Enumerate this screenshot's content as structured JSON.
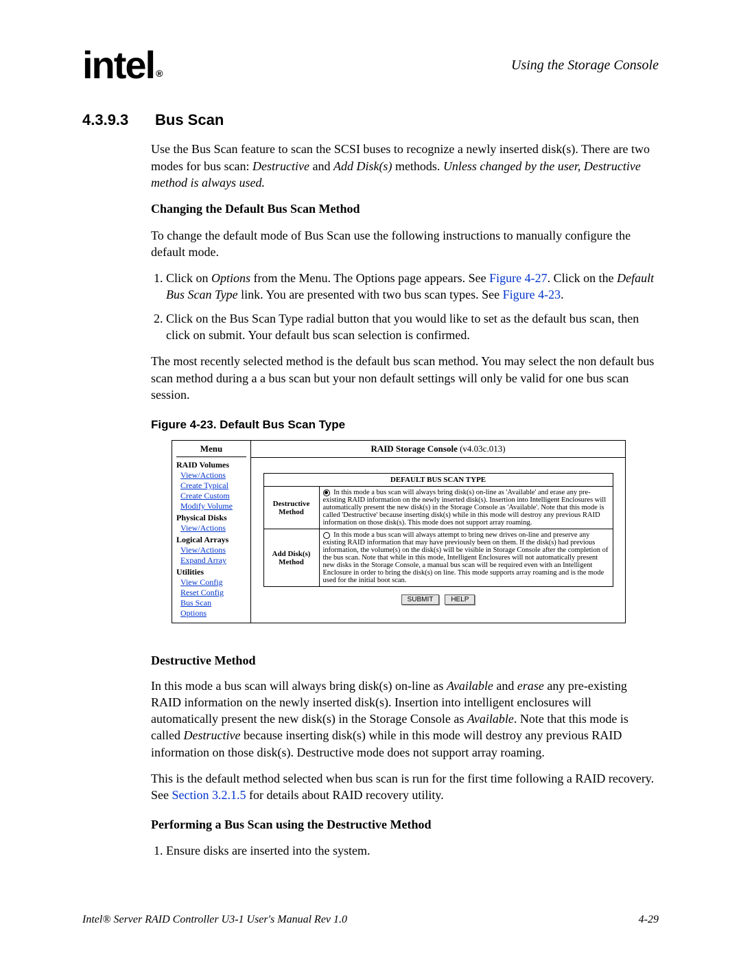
{
  "header": {
    "logo_text": "intel",
    "logo_reg": "®",
    "right": "Using the Storage Console"
  },
  "section": {
    "number": "4.3.9.3",
    "title": "Bus Scan"
  },
  "intro": {
    "p1_a": "Use the Bus Scan feature to scan the SCSI buses to recognize a newly inserted disk(s). There are two modes for bus scan: ",
    "p1_b": "Destructive",
    "p1_c": " and ",
    "p1_d": "Add Disk(s)",
    "p1_e": " methods. ",
    "p1_f": "Unless changed by the user, Destructive method is always used."
  },
  "changing": {
    "heading": "Changing the Default Bus Scan Method",
    "p": "To change the default mode of Bus Scan use the following instructions to manually configure the default mode.",
    "li1_a": "Click on ",
    "li1_b": "Options",
    "li1_c": " from the Menu. The Options page appears. See ",
    "li1_d": "Figure 4-27",
    "li1_e": ". Click on the ",
    "li1_f": "Default Bus Scan Type",
    "li1_g": " link. You are presented with two bus scan types. See ",
    "li1_h": "Figure 4-23",
    "li1_i": ".",
    "li2": "Click on the Bus Scan Type radial button that you would like to set as the default bus scan, then click on submit. Your default bus scan selection is confirmed.",
    "p2": "The most recently selected method is the default bus scan method. You may select the non default bus scan method during a a bus scan but your non default settings will only be valid for one bus scan session."
  },
  "figure_caption": "Figure 4-23. Default Bus Scan Type",
  "console": {
    "menu_title": "Menu",
    "content_title_a": "RAID Storage Console",
    "content_title_b": " (v4.03c.013)",
    "groups": {
      "raid_volumes": "RAID Volumes",
      "physical_disks": "Physical Disks",
      "logical_arrays": "Logical Arrays",
      "utilities": "Utilities"
    },
    "links": {
      "view_actions1": "View/Actions",
      "create_typical": "Create Typical",
      "create_custom": "Create Custom",
      "modify_volume": "Modify Volume",
      "view_actions2": "View/Actions",
      "view_actions3": "View/Actions",
      "expand_array": "Expand Array",
      "view_config": "View Config",
      "reset_config": "Reset Config",
      "bus_scan": "Bus Scan",
      "options": "Options"
    },
    "table_header": "DEFAULT BUS SCAN TYPE",
    "row1": {
      "method": "Destructive Method",
      "desc": " In this mode a bus scan will always bring disk(s) on-line as 'Available' and erase any pre-existing RAID information on the newly inserted disk(s). Insertion into Intelligent Enclosures will automatically present the new disk(s) in the Storage Console as 'Available'. Note that this mode is called 'Destructive' because inserting disk(s) while in this mode will destroy any previous RAID information on those disk(s). This mode does not support array roaming."
    },
    "row2": {
      "method": "Add Disk(s) Method",
      "desc": " In this mode a bus scan will always attempt to bring new drives on-line and preserve any existing RAID information that may have previously been on them. If the disk(s) had previous information, the volume(s) on the disk(s) will be visible in Storage Console after the completion of the bus scan. Note that while in this mode, Intelligent Enclosures will not automatically present new disks in the Storage Console, a manual bus scan will be required even with an Intelligent Enclosure in order to bring the disk(s) on line. This mode supports array roaming and is the mode used for the initial boot scan."
    },
    "buttons": {
      "submit": "SUBMIT",
      "help": "HELP"
    }
  },
  "destructive": {
    "heading": "Destructive Method",
    "p1_a": "In this mode a bus scan will always bring disk(s) on-line as ",
    "p1_b": "Available",
    "p1_c": " and ",
    "p1_d": "erase",
    "p1_e": " any pre-existing RAID information on the newly inserted disk(s). Insertion into intelligent enclosures will automatically present the new disk(s) in the Storage Console as ",
    "p1_f": "Available",
    "p1_g": ". Note that this mode is called ",
    "p1_h": "Destructive",
    "p1_i": " because inserting disk(s) while in this mode will destroy any previous RAID information on those disk(s). Destructive mode does not support array roaming.",
    "p2_a": "This is the default method selected when bus scan is run for the first time following a RAID recovery. See ",
    "p2_b": "Section 3.2.1.5",
    "p2_c": " for details about RAID recovery utility."
  },
  "performing": {
    "heading": "Performing a Bus Scan using the Destructive Method",
    "li1": "Ensure disks are inserted into the system."
  },
  "footer": {
    "left": "Intel® Server RAID Controller U3-1 User's Manual Rev 1.0",
    "right": "4-29"
  }
}
